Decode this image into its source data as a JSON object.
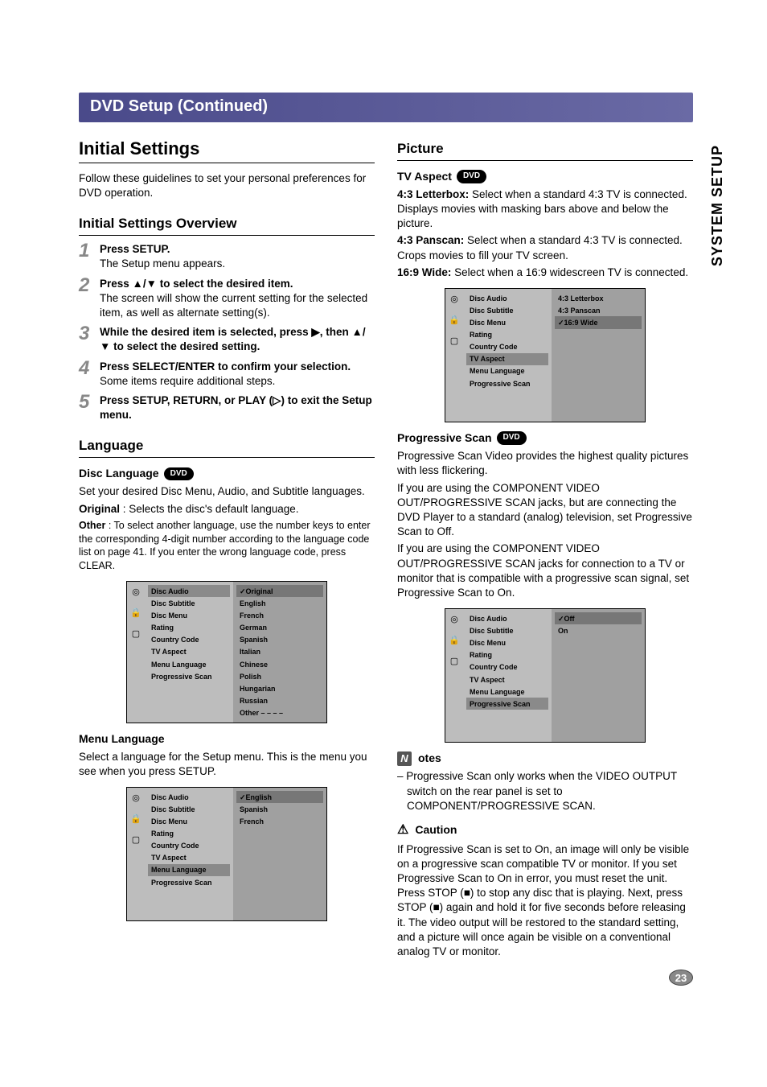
{
  "banner": "DVD Setup (Continued)",
  "side_tab": "SYSTEM SETUP",
  "page_number": "23",
  "left": {
    "h_initial": "Initial Settings",
    "intro": "Follow these guidelines to set your personal preferences for DVD operation.",
    "h_overview": "Initial Settings Overview",
    "steps": [
      {
        "n": "1",
        "bold": "Press SETUP.",
        "rest": "The Setup menu appears."
      },
      {
        "n": "2",
        "bold": "Press ▲/▼ to select the desired item.",
        "rest": "The screen will show the current setting for the selected item, as well as alternate setting(s)."
      },
      {
        "n": "3",
        "bold": "While the desired item is selected, press ▶, then ▲/▼ to select the desired setting.",
        "rest": ""
      },
      {
        "n": "4",
        "bold": "Press SELECT/ENTER to confirm your selection.",
        "rest": "Some items require additional steps."
      },
      {
        "n": "5",
        "bold": "Press SETUP, RETURN, or PLAY (▷) to exit the Setup menu.",
        "rest": ""
      }
    ],
    "h_language": "Language",
    "h_disc_lang": "Disc Language",
    "disc_lang_p1": "Set your desired Disc Menu, Audio, and Subtitle languages.",
    "disc_lang_orig_lbl": "Original",
    "disc_lang_orig_txt": " : Selects the disc's default language.",
    "disc_lang_other_lbl": "Other",
    "disc_lang_other_txt": " : To select another language, use the number keys to enter the corresponding 4-digit number according to the language code list on page 41. If you enter the wrong language code, press CLEAR.",
    "osd1": {
      "menu": [
        "Disc Audio",
        "Disc Subtitle",
        "Disc Menu",
        "Rating",
        "Country Code",
        "TV Aspect",
        "Menu Language",
        "Progressive Scan"
      ],
      "vals": [
        "✓Original",
        "English",
        "French",
        "German",
        "Spanish",
        "Italian",
        "Chinese",
        "Polish",
        "Hungarian",
        "Russian",
        "Other  – – – –"
      ],
      "hl_menu": 0,
      "hl_val": 0
    },
    "h_menu_lang": "Menu Language",
    "menu_lang_p": "Select a language for the Setup menu. This is the menu you see when you press SETUP.",
    "osd2": {
      "menu": [
        "Disc Audio",
        "Disc Subtitle",
        "Disc Menu",
        "Rating",
        "Country Code",
        "TV Aspect",
        "Menu Language",
        "Progressive Scan"
      ],
      "vals": [
        "✓English",
        "Spanish",
        "French"
      ],
      "hl_menu": 6,
      "hl_val": 0
    }
  },
  "right": {
    "h_picture": "Picture",
    "h_tvaspect": "TV Aspect",
    "tva_43l_lbl": "4:3 Letterbox:",
    "tva_43l_txt": " Select when a standard 4:3 TV is connected. Displays movies with masking bars above and below the picture.",
    "tva_43p_lbl": "4:3 Panscan:",
    "tva_43p_txt": " Select when a standard 4:3 TV is connected. Crops movies to fill your TV screen.",
    "tva_169_lbl": "16:9 Wide:",
    "tva_169_txt": " Select when a 16:9 widescreen TV is connected.",
    "osd3": {
      "menu": [
        "Disc Audio",
        "Disc Subtitle",
        "Disc Menu",
        "Rating",
        "Country Code",
        "TV Aspect",
        "Menu Language",
        "Progressive Scan"
      ],
      "vals": [
        "4:3 Letterbox",
        "4:3 Panscan",
        "✓16:9 Wide"
      ],
      "hl_menu": 5,
      "hl_val": 2
    },
    "h_progscan": "Progressive Scan",
    "ps_p1": "Progressive Scan Video provides the highest quality pictures with less flickering.",
    "ps_p2": "If you are using the COMPONENT VIDEO OUT/PROGRESSIVE SCAN jacks, but are connecting the DVD Player to a standard (analog) television, set Progressive Scan to Off.",
    "ps_p3": "If you are using the COMPONENT VIDEO OUT/PROGRESSIVE SCAN jacks for connection to a TV or monitor that is compatible with a progressive scan signal, set Progressive Scan to On.",
    "osd4": {
      "menu": [
        "Disc Audio",
        "Disc Subtitle",
        "Disc Menu",
        "Rating",
        "Country Code",
        "TV Aspect",
        "Menu Language",
        "Progressive Scan"
      ],
      "vals": [
        "✓Off",
        "On"
      ],
      "hl_menu": 7,
      "hl_val": 0
    },
    "notes_lbl": "otes",
    "notes_item": "Progressive Scan only works when the VIDEO OUTPUT switch on the rear panel is set to COMPONENT/PROGRESSIVE SCAN.",
    "caution_lbl": "Caution",
    "caution_txt": "If Progressive Scan is set to On, an image will only be visible on a progressive scan compatible TV or monitor. If you set Progressive Scan to On in error, you must reset the unit. Press STOP (■) to stop any disc that is playing. Next, press STOP (■) again and hold it for five seconds before releasing it. The video output will be restored to the standard setting, and a picture will once again be visible on a conventional analog TV or monitor."
  },
  "dvd_pill": "DVD",
  "osd_icons": [
    "◎",
    "🔒",
    "▢"
  ]
}
